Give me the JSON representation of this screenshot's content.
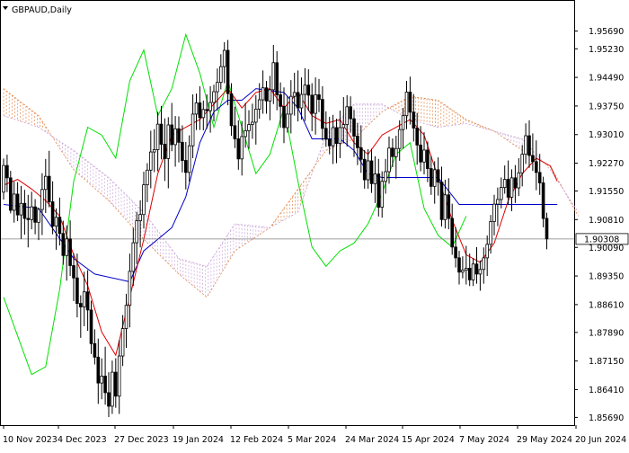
{
  "window": {
    "symbol_label": "GBPAUD,Daily",
    "menu_icon": "triangle-down-icon"
  },
  "colors": {
    "candle": "#000000",
    "tenkan": "#e00000",
    "kijun": "#0000c8",
    "chikou": "#00e000",
    "cloud_up": "#e08040",
    "cloud_down": "#c8a0d8",
    "current_price_bg": "#ffffff",
    "background": "#ffffff"
  },
  "chart_data": {
    "type": "candlestick",
    "title": "GBPAUD,Daily",
    "ylim": [
      1.8549,
      1.9647
    ],
    "y_ticks": [
      "1.95690",
      "1.95230",
      "1.94490",
      "1.93750",
      "1.93010",
      "1.92270",
      "1.91550",
      "1.90810",
      "1.90090",
      "1.89350",
      "1.88610",
      "1.87890",
      "1.87150",
      "1.86410",
      "1.85690"
    ],
    "x_ticks": [
      "10 Nov 2023",
      "4 Dec 2023",
      "27 Dec 2023",
      "19 Jan 2024",
      "12 Feb 2024",
      "5 Mar 2024",
      "24 Mar 2024",
      "15 Apr 2024",
      "7 May 2024",
      "29 May 2024",
      "20 Jun 2024"
    ],
    "current_price": "1.90308",
    "candles": [
      [
        1.9152,
        1.9239,
        1.9133,
        1.9221
      ],
      [
        1.9221,
        1.9249,
        1.9152,
        1.9189
      ],
      [
        1.9189,
        1.9207,
        1.9097,
        1.9105
      ],
      [
        1.9105,
        1.9179,
        1.9073,
        1.9147
      ],
      [
        1.9147,
        1.9178,
        1.9077,
        1.9093
      ],
      [
        1.9093,
        1.9168,
        1.9031,
        1.9123
      ],
      [
        1.9123,
        1.9158,
        1.9042,
        1.9084
      ],
      [
        1.9084,
        1.9145,
        1.9009,
        1.9081
      ],
      [
        1.9081,
        1.9153,
        1.9056,
        1.9114
      ],
      [
        1.9114,
        1.9134,
        1.9043,
        1.9074
      ],
      [
        1.9074,
        1.9112,
        1.9028,
        1.9107
      ],
      [
        1.9107,
        1.9201,
        1.9041,
        1.9159
      ],
      [
        1.9159,
        1.9238,
        1.9098,
        1.9193
      ],
      [
        1.9193,
        1.9259,
        1.9113,
        1.9127
      ],
      [
        1.9127,
        1.918,
        1.9043,
        1.9064
      ],
      [
        1.9064,
        1.911,
        1.9003,
        1.9087
      ],
      [
        1.9087,
        1.9138,
        1.9014,
        1.9045
      ],
      [
        1.9045,
        1.9078,
        1.8964,
        1.8988
      ],
      [
        1.8988,
        1.9066,
        1.8923,
        1.9031
      ],
      [
        1.9031,
        1.9079,
        1.8935,
        1.8962
      ],
      [
        1.8962,
        1.8994,
        1.887,
        1.893
      ],
      [
        1.893,
        1.8993,
        1.8828,
        1.8864
      ],
      [
        1.8864,
        1.8885,
        1.8775,
        1.8855
      ],
      [
        1.8855,
        1.8946,
        1.8805,
        1.8894
      ],
      [
        1.8894,
        1.895,
        1.8793,
        1.8847
      ],
      [
        1.8847,
        1.8871,
        1.8733,
        1.876
      ],
      [
        1.876,
        1.8797,
        1.8706,
        1.8725
      ],
      [
        1.8725,
        1.8773,
        1.8604,
        1.8658
      ],
      [
        1.8658,
        1.8722,
        1.8616,
        1.8676
      ],
      [
        1.8676,
        1.8752,
        1.8602,
        1.8633
      ],
      [
        1.8633,
        1.8686,
        1.857,
        1.8598
      ],
      [
        1.8598,
        1.8716,
        1.8578,
        1.8686
      ],
      [
        1.8686,
        1.8722,
        1.8594,
        1.8624
      ],
      [
        1.8624,
        1.8769,
        1.8578,
        1.8728
      ],
      [
        1.8728,
        1.8834,
        1.8702,
        1.8799
      ],
      [
        1.8799,
        1.8889,
        1.8749,
        1.8859
      ],
      [
        1.8859,
        1.8993,
        1.8802,
        1.8947
      ],
      [
        1.8947,
        1.906,
        1.8909,
        1.9021
      ],
      [
        1.9021,
        1.9101,
        1.8966,
        1.9078
      ],
      [
        1.9078,
        1.9131,
        1.9009,
        1.9094
      ],
      [
        1.9094,
        1.9205,
        1.9058,
        1.9171
      ],
      [
        1.9171,
        1.9227,
        1.9126,
        1.9209
      ],
      [
        1.9209,
        1.9311,
        1.9162,
        1.9256
      ],
      [
        1.9256,
        1.9315,
        1.9204,
        1.9262
      ],
      [
        1.9262,
        1.936,
        1.9206,
        1.9328
      ],
      [
        1.9328,
        1.9375,
        1.9237,
        1.9276
      ],
      [
        1.9276,
        1.9343,
        1.9181,
        1.9239
      ],
      [
        1.9239,
        1.9346,
        1.9162,
        1.9326
      ],
      [
        1.9326,
        1.9383,
        1.9258,
        1.9275
      ],
      [
        1.9275,
        1.9349,
        1.9218,
        1.9316
      ],
      [
        1.9316,
        1.9348,
        1.9229,
        1.9281
      ],
      [
        1.9281,
        1.9325,
        1.9203,
        1.9234
      ],
      [
        1.9234,
        1.9282,
        1.9159,
        1.9203
      ],
      [
        1.9203,
        1.9299,
        1.9179,
        1.9272
      ],
      [
        1.9272,
        1.9405,
        1.924,
        1.9354
      ],
      [
        1.9354,
        1.9407,
        1.9313,
        1.9383
      ],
      [
        1.9383,
        1.9426,
        1.9313,
        1.9345
      ],
      [
        1.9345,
        1.9389,
        1.9312,
        1.9366
      ],
      [
        1.9366,
        1.9405,
        1.9316,
        1.9363
      ],
      [
        1.9363,
        1.9426,
        1.9306,
        1.9384
      ],
      [
        1.9384,
        1.943,
        1.9335,
        1.9412
      ],
      [
        1.9412,
        1.9472,
        1.9363,
        1.9436
      ],
      [
        1.9436,
        1.9509,
        1.9418,
        1.9477
      ],
      [
        1.9477,
        1.954,
        1.9434,
        1.9519
      ],
      [
        1.9519,
        1.9546,
        1.9377,
        1.9407
      ],
      [
        1.9407,
        1.9434,
        1.9298,
        1.9324
      ],
      [
        1.9324,
        1.9373,
        1.9266,
        1.929
      ],
      [
        1.929,
        1.9338,
        1.921,
        1.9238
      ],
      [
        1.9238,
        1.9336,
        1.9195,
        1.9296
      ],
      [
        1.9296,
        1.9383,
        1.9267,
        1.9311
      ],
      [
        1.9311,
        1.9364,
        1.9264,
        1.9327
      ],
      [
        1.9327,
        1.9381,
        1.929,
        1.9333
      ],
      [
        1.9333,
        1.9403,
        1.9275,
        1.9367
      ],
      [
        1.9367,
        1.9434,
        1.9342,
        1.9391
      ],
      [
        1.9391,
        1.9467,
        1.9355,
        1.9422
      ],
      [
        1.9422,
        1.944,
        1.9355,
        1.9388
      ],
      [
        1.9388,
        1.9453,
        1.9338,
        1.9417
      ],
      [
        1.9417,
        1.9533,
        1.938,
        1.9487
      ],
      [
        1.9487,
        1.9517,
        1.9364,
        1.9404
      ],
      [
        1.9404,
        1.9436,
        1.9319,
        1.9374
      ],
      [
        1.9374,
        1.9423,
        1.9279,
        1.9319
      ],
      [
        1.9319,
        1.9401,
        1.9306,
        1.9354
      ],
      [
        1.9354,
        1.9442,
        1.9304,
        1.94
      ],
      [
        1.94,
        1.9461,
        1.935,
        1.941
      ],
      [
        1.941,
        1.9467,
        1.9335,
        1.937
      ],
      [
        1.937,
        1.9449,
        1.934,
        1.9405
      ],
      [
        1.9405,
        1.9473,
        1.9336,
        1.9429
      ],
      [
        1.9429,
        1.947,
        1.9362,
        1.9403
      ],
      [
        1.9403,
        1.9434,
        1.931,
        1.9356
      ],
      [
        1.9356,
        1.9449,
        1.9301,
        1.9404
      ],
      [
        1.9404,
        1.9445,
        1.9359,
        1.9392
      ],
      [
        1.9392,
        1.9426,
        1.9286,
        1.9317
      ],
      [
        1.9317,
        1.9361,
        1.927,
        1.9289
      ],
      [
        1.9289,
        1.9347,
        1.925,
        1.9272
      ],
      [
        1.9272,
        1.9352,
        1.9225,
        1.9319
      ],
      [
        1.9319,
        1.9342,
        1.9227,
        1.9278
      ],
      [
        1.9278,
        1.9363,
        1.924,
        1.9319
      ],
      [
        1.9319,
        1.9398,
        1.9279,
        1.9327
      ],
      [
        1.9327,
        1.9403,
        1.927,
        1.9373
      ],
      [
        1.9373,
        1.94,
        1.9306,
        1.9342
      ],
      [
        1.9342,
        1.9365,
        1.9243,
        1.9297
      ],
      [
        1.9297,
        1.9331,
        1.9222,
        1.9267
      ],
      [
        1.9267,
        1.9325,
        1.9202,
        1.9237
      ],
      [
        1.9237,
        1.9261,
        1.9161,
        1.9184
      ],
      [
        1.9184,
        1.9263,
        1.9161,
        1.9233
      ],
      [
        1.9233,
        1.9264,
        1.915,
        1.9174
      ],
      [
        1.9174,
        1.9245,
        1.9124,
        1.9199
      ],
      [
        1.9199,
        1.9238,
        1.9089,
        1.9113
      ],
      [
        1.9113,
        1.9206,
        1.9086,
        1.918
      ],
      [
        1.918,
        1.9238,
        1.9148,
        1.9205
      ],
      [
        1.9205,
        1.9296,
        1.9174,
        1.9266
      ],
      [
        1.9266,
        1.9291,
        1.9217,
        1.9244
      ],
      [
        1.9244,
        1.9298,
        1.9187,
        1.9265
      ],
      [
        1.9265,
        1.9338,
        1.9233,
        1.9314
      ],
      [
        1.9314,
        1.937,
        1.9265,
        1.935
      ],
      [
        1.935,
        1.944,
        1.9315,
        1.9411
      ],
      [
        1.9411,
        1.9451,
        1.9327,
        1.9359
      ],
      [
        1.9359,
        1.9406,
        1.9283,
        1.9318
      ],
      [
        1.9318,
        1.9357,
        1.9223,
        1.9274
      ],
      [
        1.9274,
        1.9323,
        1.9206,
        1.923
      ],
      [
        1.923,
        1.9307,
        1.9198,
        1.9261
      ],
      [
        1.9261,
        1.9283,
        1.9178,
        1.9213
      ],
      [
        1.9213,
        1.9246,
        1.9145,
        1.9167
      ],
      [
        1.9167,
        1.9232,
        1.9122,
        1.921
      ],
      [
        1.921,
        1.9242,
        1.9143,
        1.9178
      ],
      [
        1.9178,
        1.9218,
        1.9063,
        1.9081
      ],
      [
        1.9081,
        1.9184,
        1.9058,
        1.9145
      ],
      [
        1.9145,
        1.9188,
        1.9056,
        1.9084
      ],
      [
        1.9084,
        1.9122,
        1.899,
        1.901
      ],
      [
        1.901,
        1.9061,
        1.8957,
        1.8982
      ],
      [
        1.8982,
        1.9,
        1.8913,
        1.8945
      ],
      [
        1.8945,
        1.8986,
        1.8929,
        1.895
      ],
      [
        1.895,
        1.9013,
        1.8913,
        1.8955
      ],
      [
        1.8955,
        1.8993,
        1.8909,
        1.8925
      ],
      [
        1.8925,
        1.8981,
        1.8909,
        1.8966
      ],
      [
        1.8966,
        1.901,
        1.8915,
        1.894
      ],
      [
        1.894,
        1.8975,
        1.8897,
        1.8952
      ],
      [
        1.8952,
        1.9009,
        1.8915,
        1.8982
      ],
      [
        1.8982,
        1.904,
        1.8935,
        1.9017
      ],
      [
        1.9017,
        1.9093,
        1.8993,
        1.9076
      ],
      [
        1.9076,
        1.9145,
        1.904,
        1.9121
      ],
      [
        1.9121,
        1.9164,
        1.9064,
        1.9133
      ],
      [
        1.9133,
        1.919,
        1.911,
        1.9164
      ],
      [
        1.9164,
        1.9221,
        1.9148,
        1.9185
      ],
      [
        1.9185,
        1.9234,
        1.9119,
        1.9139
      ],
      [
        1.9139,
        1.9211,
        1.9103,
        1.9189
      ],
      [
        1.9189,
        1.9222,
        1.9124,
        1.9163
      ],
      [
        1.9163,
        1.924,
        1.9142,
        1.9202
      ],
      [
        1.9202,
        1.9274,
        1.9167,
        1.925
      ],
      [
        1.925,
        1.933,
        1.9225,
        1.9298
      ],
      [
        1.9298,
        1.9338,
        1.9215,
        1.9247
      ],
      [
        1.9247,
        1.9304,
        1.9207,
        1.9231
      ],
      [
        1.9231,
        1.9286,
        1.9157,
        1.9203
      ],
      [
        1.9203,
        1.9251,
        1.9145,
        1.9176
      ],
      [
        1.9176,
        1.9192,
        1.9061,
        1.9084
      ],
      [
        1.9084,
        1.9099,
        1.9004,
        1.9031
      ]
    ],
    "tenkan": [
      [
        0,
        1.917
      ],
      [
        4,
        1.9185
      ],
      [
        8,
        1.916
      ],
      [
        12,
        1.913
      ],
      [
        16,
        1.909
      ],
      [
        20,
        1.899
      ],
      [
        24,
        1.891
      ],
      [
        28,
        1.879
      ],
      [
        32,
        1.873
      ],
      [
        36,
        1.888
      ],
      [
        40,
        1.903
      ],
      [
        44,
        1.92
      ],
      [
        48,
        1.93
      ],
      [
        52,
        1.932
      ],
      [
        56,
        1.934
      ],
      [
        60,
        1.938
      ],
      [
        64,
        1.942
      ],
      [
        68,
        1.937
      ],
      [
        72,
        1.941
      ],
      [
        76,
        1.942
      ],
      [
        80,
        1.937
      ],
      [
        84,
        1.941
      ],
      [
        88,
        1.935
      ],
      [
        92,
        1.933
      ],
      [
        96,
        1.934
      ],
      [
        100,
        1.928
      ],
      [
        104,
        1.925
      ],
      [
        108,
        1.93
      ],
      [
        112,
        1.932
      ],
      [
        116,
        1.934
      ],
      [
        120,
        1.93
      ],
      [
        124,
        1.919
      ],
      [
        128,
        1.908
      ],
      [
        132,
        1.899
      ],
      [
        136,
        1.897
      ],
      [
        140,
        1.902
      ],
      [
        144,
        1.913
      ],
      [
        148,
        1.92
      ],
      [
        152,
        1.924
      ],
      [
        156,
        1.922
      ],
      [
        158,
        1.918
      ]
    ],
    "kijun": [
      [
        0,
        1.912
      ],
      [
        10,
        1.911
      ],
      [
        20,
        1.898
      ],
      [
        26,
        1.894
      ],
      [
        36,
        1.892
      ],
      [
        40,
        1.9
      ],
      [
        48,
        1.906
      ],
      [
        52,
        1.914
      ],
      [
        56,
        1.928
      ],
      [
        60,
        1.936
      ],
      [
        64,
        1.939
      ],
      [
        68,
        1.939
      ],
      [
        72,
        1.942
      ],
      [
        80,
        1.941
      ],
      [
        84,
        1.937
      ],
      [
        88,
        1.929
      ],
      [
        96,
        1.929
      ],
      [
        100,
        1.926
      ],
      [
        104,
        1.92
      ],
      [
        108,
        1.919
      ],
      [
        116,
        1.919
      ],
      [
        124,
        1.919
      ],
      [
        130,
        1.912
      ],
      [
        136,
        1.912
      ],
      [
        140,
        1.912
      ],
      [
        144,
        1.912
      ],
      [
        150,
        1.912
      ],
      [
        158,
        1.912
      ]
    ],
    "chikou": [
      [
        0,
        1.888
      ],
      [
        4,
        1.878
      ],
      [
        8,
        1.868
      ],
      [
        12,
        1.87
      ],
      [
        16,
        1.89
      ],
      [
        20,
        1.918
      ],
      [
        24,
        1.932
      ],
      [
        28,
        1.93
      ],
      [
        32,
        1.924
      ],
      [
        36,
        1.944
      ],
      [
        40,
        1.952
      ],
      [
        44,
        1.935
      ],
      [
        48,
        1.942
      ],
      [
        52,
        1.956
      ],
      [
        56,
        1.946
      ],
      [
        60,
        1.932
      ],
      [
        64,
        1.944
      ],
      [
        68,
        1.932
      ],
      [
        72,
        1.92
      ],
      [
        76,
        1.925
      ],
      [
        80,
        1.937
      ],
      [
        84,
        1.918
      ],
      [
        88,
        1.901
      ],
      [
        92,
        1.896
      ],
      [
        96,
        1.9
      ],
      [
        100,
        1.902
      ],
      [
        104,
        1.907
      ],
      [
        108,
        1.915
      ],
      [
        112,
        1.925
      ],
      [
        116,
        1.928
      ],
      [
        120,
        1.911
      ],
      [
        124,
        1.904
      ],
      [
        128,
        1.901
      ],
      [
        132,
        1.909
      ]
    ],
    "senkou_a": [
      [
        0,
        1.942
      ],
      [
        10,
        1.935
      ],
      [
        20,
        1.921
      ],
      [
        30,
        1.913
      ],
      [
        40,
        1.903
      ],
      [
        50,
        1.894
      ],
      [
        58,
        1.888
      ],
      [
        66,
        1.9
      ],
      [
        76,
        1.906
      ],
      [
        84,
        1.916
      ],
      [
        92,
        1.926
      ],
      [
        100,
        1.929
      ],
      [
        108,
        1.936
      ],
      [
        116,
        1.94
      ],
      [
        124,
        1.939
      ],
      [
        132,
        1.934
      ],
      [
        140,
        1.931
      ],
      [
        148,
        1.926
      ],
      [
        156,
        1.922
      ],
      [
        164,
        1.909
      ]
    ],
    "senkou_b": [
      [
        0,
        1.935
      ],
      [
        10,
        1.932
      ],
      [
        20,
        1.926
      ],
      [
        30,
        1.919
      ],
      [
        40,
        1.91
      ],
      [
        50,
        1.898
      ],
      [
        58,
        1.896
      ],
      [
        66,
        1.907
      ],
      [
        76,
        1.906
      ],
      [
        84,
        1.91
      ],
      [
        92,
        1.93
      ],
      [
        100,
        1.938
      ],
      [
        108,
        1.938
      ],
      [
        116,
        1.934
      ],
      [
        124,
        1.932
      ],
      [
        132,
        1.933
      ],
      [
        140,
        1.931
      ],
      [
        148,
        1.929
      ],
      [
        156,
        1.921
      ],
      [
        164,
        1.91
      ]
    ]
  }
}
